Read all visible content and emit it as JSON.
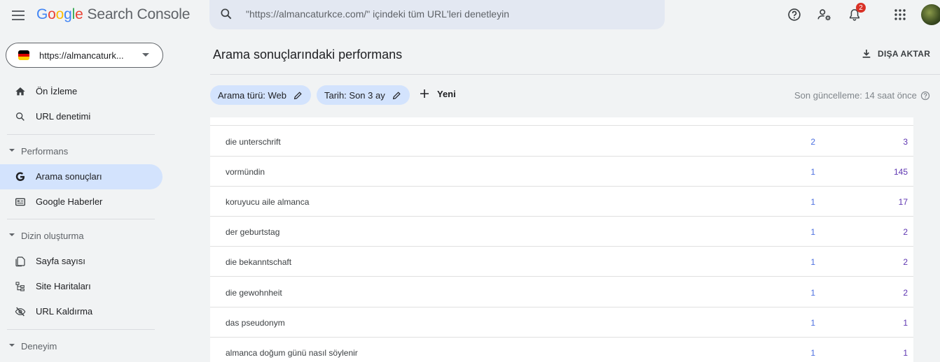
{
  "header": {
    "logo_google": [
      "G",
      "o",
      "o",
      "g",
      "l",
      "e"
    ],
    "logo_product": "Search Console",
    "search_placeholder": "\"https://almancaturkce.com/\" içindeki tüm URL'leri denetleyin",
    "notification_count": "2"
  },
  "sidebar": {
    "property": "https://almancaturk...",
    "items_top": [
      {
        "label": "Ön İzleme",
        "icon": "home-icon"
      },
      {
        "label": "URL denetimi",
        "icon": "search-icon"
      }
    ],
    "section_performance": "Performans",
    "items_performance": [
      {
        "label": "Arama sonuçları",
        "icon": "google-g-icon",
        "active": true
      },
      {
        "label": "Google Haberler",
        "icon": "news-icon"
      }
    ],
    "section_index": "Dizin oluşturma",
    "items_index": [
      {
        "label": "Sayfa sayısı",
        "icon": "pages-icon"
      },
      {
        "label": "Site Haritaları",
        "icon": "sitemap-icon"
      },
      {
        "label": "URL Kaldırma",
        "icon": "eye-off-icon"
      }
    ],
    "section_experience": "Deneyim"
  },
  "main": {
    "title": "Arama sonuçlarındaki performans",
    "export_label": "DIŞA AKTAR",
    "filters": [
      {
        "label": "Arama türü: Web"
      },
      {
        "label": "Tarih: Son 3 ay"
      }
    ],
    "new_label": "Yeni",
    "last_updated": "Son güncelleme: 14 saat önce"
  },
  "table": {
    "rows": [
      {
        "query": "die unterschrift",
        "clicks": "2",
        "impressions": "3"
      },
      {
        "query": "vormündin",
        "clicks": "1",
        "impressions": "145"
      },
      {
        "query": "koruyucu aile almanca",
        "clicks": "1",
        "impressions": "17"
      },
      {
        "query": "der geburtstag",
        "clicks": "1",
        "impressions": "2"
      },
      {
        "query": "die bekanntschaft",
        "clicks": "1",
        "impressions": "2"
      },
      {
        "query": "die gewohnheit",
        "clicks": "1",
        "impressions": "2"
      },
      {
        "query": "das pseudonym",
        "clicks": "1",
        "impressions": "1"
      },
      {
        "query": "almanca doğum günü nasıl söylenir",
        "clicks": "1",
        "impressions": "1"
      }
    ]
  },
  "colors": {
    "accent": "#d3e3fd",
    "clicks": "#4a6ee0",
    "impressions": "#5e35b1"
  }
}
